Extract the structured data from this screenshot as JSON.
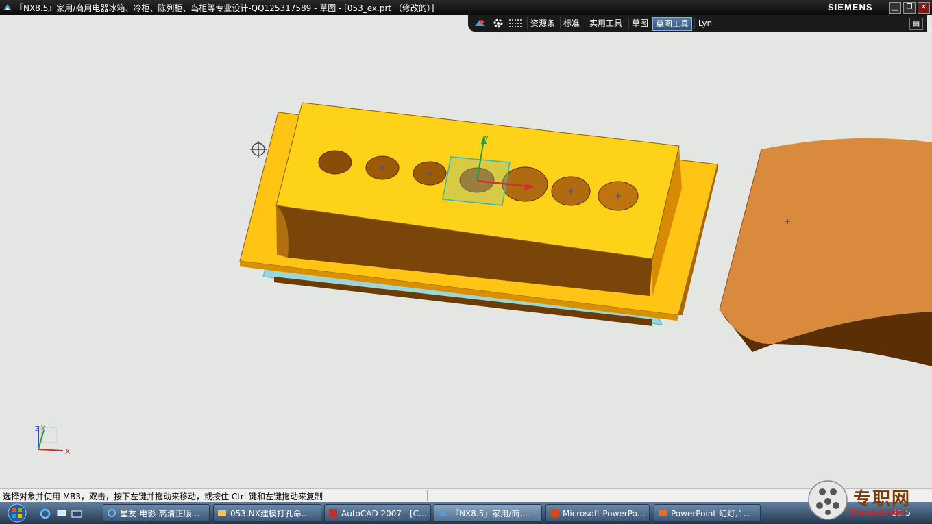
{
  "window": {
    "title": "『NX8.5』家用/商用电器冰箱、冷柜、陈列柜、岛柜等专业设计-QQ125317589 - 草图 - [053_ex.prt （修改的）]",
    "brand": "SIEMENS",
    "buttons": {
      "minimize": "▁",
      "restore": "❐",
      "close": "✕"
    }
  },
  "toolbar": {
    "items": [
      "资源条",
      "标准",
      "实用工具",
      "草图",
      "草图工具",
      "Lyn"
    ],
    "active": "草图工具"
  },
  "viewport": {
    "axis_labels": {
      "x": "X",
      "y": "Y",
      "z": "Z",
      "triad_y": "Y"
    },
    "colors": {
      "background": "#e4e6e4",
      "part_top": "#ffd21a",
      "part_side": "#7a4a08",
      "plate": "#ffc010",
      "curved_part": "#d98a3c",
      "highlight": "#40c0c8"
    }
  },
  "status": {
    "prompt": "选择对象并使用 MB3，双击，按下左键并拖动来移动，或按住 Ctrl 键和左键拖动来复制"
  },
  "taskbar": {
    "tasks": [
      {
        "label": "星友-电影-高清正版...",
        "icon": "ie-icon"
      },
      {
        "label": "053.NX建模打孔命...",
        "icon": "folder-icon"
      },
      {
        "label": "AutoCAD 2007 - [C...",
        "icon": "autocad-icon"
      },
      {
        "label": "『NX8.5』家用/商...",
        "icon": "nx-icon",
        "active": true
      },
      {
        "label": "Microsoft PowerPo...",
        "icon": "powerpoint-icon"
      },
      {
        "label": "PowerPoint 幻灯片...",
        "icon": "slideshow-icon"
      }
    ],
    "clock": "21:5"
  },
  "watermark": {
    "text": "专职网",
    "url": "Zhuanzhi.Net"
  }
}
